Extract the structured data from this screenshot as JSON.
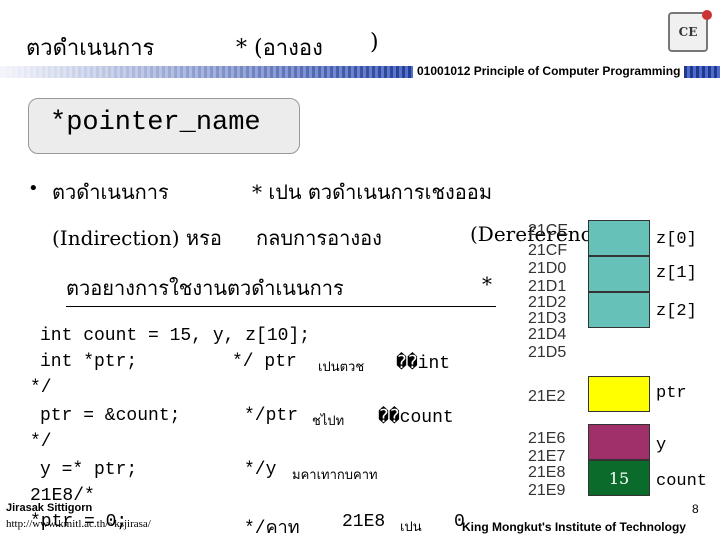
{
  "header": {
    "title": "ตวดำเนนการ",
    "title_star": "* (อางอง",
    "title_paren": ")",
    "logo_text": "CE",
    "course": "01001012 Principle of Computer Programming"
  },
  "syntax_box": "*pointer_name",
  "bullet": {
    "symbol": "•",
    "line1a": "ตวดำเนนการ",
    "line1b": "* เปน  ตวดำเนนการเชงออม",
    "line2a": "(Indirection) หรอ",
    "line2b": "กลบการอางอง",
    "line2c": "(Dereference)"
  },
  "example": {
    "text": "ตวอยางการใชงานตวดำเนนการ",
    "star": "*"
  },
  "code": [
    {
      "a": "int   count = 15, y, z[10];",
      "b": "",
      "c": ""
    },
    {
      "a": "int   *ptr;",
      "b": "*/ ptr",
      "c": "เปนตวช",
      "d": "��int"
    },
    {
      "a": "*/"
    },
    {
      "a": "ptr = &count;",
      "b": "*/ptr",
      "c": "ชไปท",
      "d": "��count"
    },
    {
      "a": "*/"
    },
    {
      "a": "y   =* ptr;",
      "b": "*/y",
      "c": "มคาเทากบคาท"
    },
    {
      "a": "21E8/*"
    },
    {
      "a": "*ptr = 0;",
      "b": "*/คาท",
      "c": "21E8",
      "d": "เปน",
      "e": "0"
    }
  ],
  "memory": {
    "addresses": [
      "21CE",
      "21CF",
      "21D0",
      "21D1",
      "21D2",
      "21D3",
      "21D4",
      "21D5",
      "21E2",
      "21E6",
      "21E7",
      "21E8",
      "21E9"
    ],
    "labels": {
      "z0": "z[0]",
      "z1": "z[1]",
      "z2": "z[2]",
      "ptr": "ptr",
      "y": "y",
      "count": "count"
    },
    "count_value": "15",
    "colors": {
      "array": "#66c2b8",
      "ptr": "#ffff00",
      "y": "#a0306a",
      "count": "#0b6b2a"
    }
  },
  "footer": {
    "author": "Jirasak Sittigorn",
    "url": "http://www.kmitl.ac.th/~ksjirasa/",
    "institute": "King Mongkut's Institute of Technology",
    "page": "8"
  }
}
